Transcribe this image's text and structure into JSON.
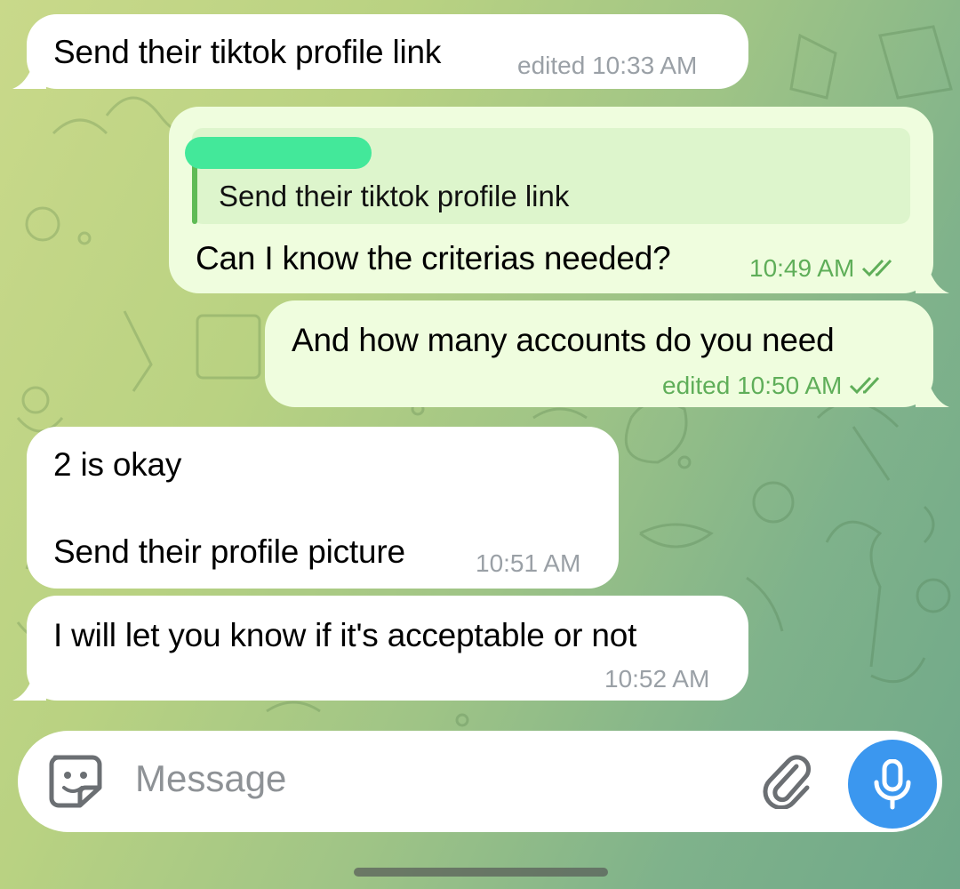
{
  "messages": [
    {
      "direction": "incoming",
      "text": "Send their tiktok profile link",
      "meta": "edited 10:33 AM"
    },
    {
      "direction": "outgoing",
      "reply_quote": "Send their tiktok profile link",
      "text": "Can I know the criterias needed?",
      "meta": "10:49 AM",
      "status": "read"
    },
    {
      "direction": "outgoing",
      "text": "And how many accounts do you need",
      "meta": "edited 10:50 AM",
      "status": "read"
    },
    {
      "direction": "incoming",
      "text_line1": "2 is okay",
      "text_line2": "Send their profile picture",
      "meta": "10:51 AM"
    },
    {
      "direction": "incoming",
      "text": "I will let you know if it's acceptable or not",
      "meta": "10:52 AM"
    }
  ],
  "composer": {
    "placeholder": "Message",
    "left_icon": "sticker-icon",
    "attach_icon": "paperclip-icon",
    "send_icon": "microphone-icon"
  },
  "colors": {
    "incoming_bubble": "#ffffff",
    "outgoing_bubble": "#effdde",
    "outgoing_meta": "#5fae59",
    "mic_button": "#3b97ef",
    "reply_bar": "#5fbb55"
  }
}
